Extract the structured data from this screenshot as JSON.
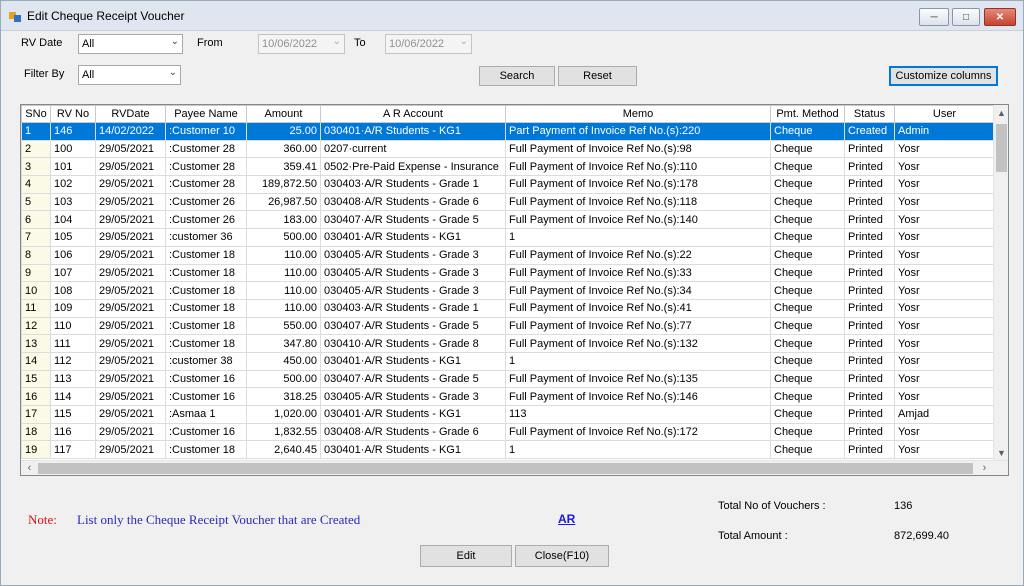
{
  "window": {
    "title": "Edit Cheque Receipt Voucher"
  },
  "filters": {
    "rv_date_label": "RV Date",
    "rv_date_value": "All",
    "from_label": "From",
    "from_value": "10/06/2022",
    "to_label": "To",
    "to_value": "10/06/2022",
    "filter_by_label": "Filter By",
    "filter_by_value": "All"
  },
  "buttons": {
    "search": "Search",
    "reset": "Reset",
    "customize": "Customize columns",
    "edit": "Edit",
    "close": "Close(F10)"
  },
  "grid": {
    "columns": [
      "SNo",
      "RV No",
      "RVDate",
      "Payee Name",
      "Amount",
      "A R Account",
      "Memo",
      "Pmt. Method",
      "Status",
      "User"
    ],
    "rows": [
      [
        "1",
        "146",
        "14/02/2022",
        ":Customer 10",
        "25.00",
        "030401·A/R Students - KG1",
        "Part Payment of Invoice Ref No.(s):220",
        "Cheque",
        "Created",
        "Admin"
      ],
      [
        "2",
        "100",
        "29/05/2021",
        ":Customer 28",
        "360.00",
        "0207·current",
        "Full Payment of Invoice Ref No.(s):98",
        "Cheque",
        "Printed",
        "Yosr"
      ],
      [
        "3",
        "101",
        "29/05/2021",
        ":Customer 28",
        "359.41",
        "0502·Pre-Paid Expense - Insurance",
        "Full Payment of Invoice Ref No.(s):110",
        "Cheque",
        "Printed",
        "Yosr"
      ],
      [
        "4",
        "102",
        "29/05/2021",
        ":Customer 28",
        "189,872.50",
        "030403·A/R Students - Grade 1",
        "Full Payment of Invoice Ref No.(s):178",
        "Cheque",
        "Printed",
        "Yosr"
      ],
      [
        "5",
        "103",
        "29/05/2021",
        ":Customer 26",
        "26,987.50",
        "030408·A/R Students - Grade 6",
        "Full Payment of Invoice Ref No.(s):118",
        "Cheque",
        "Printed",
        "Yosr"
      ],
      [
        "6",
        "104",
        "29/05/2021",
        ":Customer 26",
        "183.00",
        "030407·A/R Students - Grade 5",
        "Full Payment of Invoice Ref No.(s):140",
        "Cheque",
        "Printed",
        "Yosr"
      ],
      [
        "7",
        "105",
        "29/05/2021",
        ":customer 36",
        "500.00",
        "030401·A/R Students - KG1",
        "1",
        "Cheque",
        "Printed",
        "Yosr"
      ],
      [
        "8",
        "106",
        "29/05/2021",
        ":Customer 18",
        "110.00",
        "030405·A/R Students - Grade 3",
        "Full Payment of Invoice Ref No.(s):22",
        "Cheque",
        "Printed",
        "Yosr"
      ],
      [
        "9",
        "107",
        "29/05/2021",
        ":Customer 18",
        "110.00",
        "030405·A/R Students - Grade 3",
        "Full Payment of Invoice Ref No.(s):33",
        "Cheque",
        "Printed",
        "Yosr"
      ],
      [
        "10",
        "108",
        "29/05/2021",
        ":Customer 18",
        "110.00",
        "030405·A/R Students - Grade 3",
        "Full Payment of Invoice Ref No.(s):34",
        "Cheque",
        "Printed",
        "Yosr"
      ],
      [
        "11",
        "109",
        "29/05/2021",
        ":Customer 18",
        "110.00",
        "030403·A/R Students - Grade 1",
        "Full Payment of Invoice Ref No.(s):41",
        "Cheque",
        "Printed",
        "Yosr"
      ],
      [
        "12",
        "110",
        "29/05/2021",
        ":Customer 18",
        "550.00",
        "030407·A/R Students - Grade 5",
        "Full Payment of Invoice Ref No.(s):77",
        "Cheque",
        "Printed",
        "Yosr"
      ],
      [
        "13",
        "111",
        "29/05/2021",
        ":Customer 18",
        "347.80",
        "030410·A/R Students - Grade 8",
        "Full Payment of Invoice Ref No.(s):132",
        "Cheque",
        "Printed",
        "Yosr"
      ],
      [
        "14",
        "112",
        "29/05/2021",
        ":customer 38",
        "450.00",
        "030401·A/R Students - KG1",
        "1",
        "Cheque",
        "Printed",
        "Yosr"
      ],
      [
        "15",
        "113",
        "29/05/2021",
        ":Customer 16",
        "500.00",
        "030407·A/R Students - Grade 5",
        "Full Payment of Invoice Ref No.(s):135",
        "Cheque",
        "Printed",
        "Yosr"
      ],
      [
        "16",
        "114",
        "29/05/2021",
        ":Customer 16",
        "318.25",
        "030405·A/R Students - Grade 3",
        "Full Payment of Invoice Ref No.(s):146",
        "Cheque",
        "Printed",
        "Yosr"
      ],
      [
        "17",
        "115",
        "29/05/2021",
        ":Asmaa 1",
        "1,020.00",
        "030401·A/R Students - KG1",
        "113",
        "Cheque",
        "Printed",
        "Amjad"
      ],
      [
        "18",
        "116",
        "29/05/2021",
        ":Customer 16",
        "1,832.55",
        "030408·A/R Students - Grade 6",
        "Full Payment of Invoice Ref No.(s):172",
        "Cheque",
        "Printed",
        "Yosr"
      ],
      [
        "19",
        "117",
        "29/05/2021",
        ":Customer 18",
        "2,640.45",
        "030401·A/R Students - KG1",
        "1",
        "Cheque",
        "Printed",
        "Yosr"
      ]
    ],
    "selected_row": 0
  },
  "footer": {
    "note_label": "Note:",
    "note_text": "List only the Cheque Receipt Voucher that are Created",
    "ar_link": "AR",
    "total_vouchers_label": "Total No of Vouchers :",
    "total_vouchers_value": "136",
    "total_amount_label": "Total Amount :",
    "total_amount_value": "872,699.40"
  }
}
